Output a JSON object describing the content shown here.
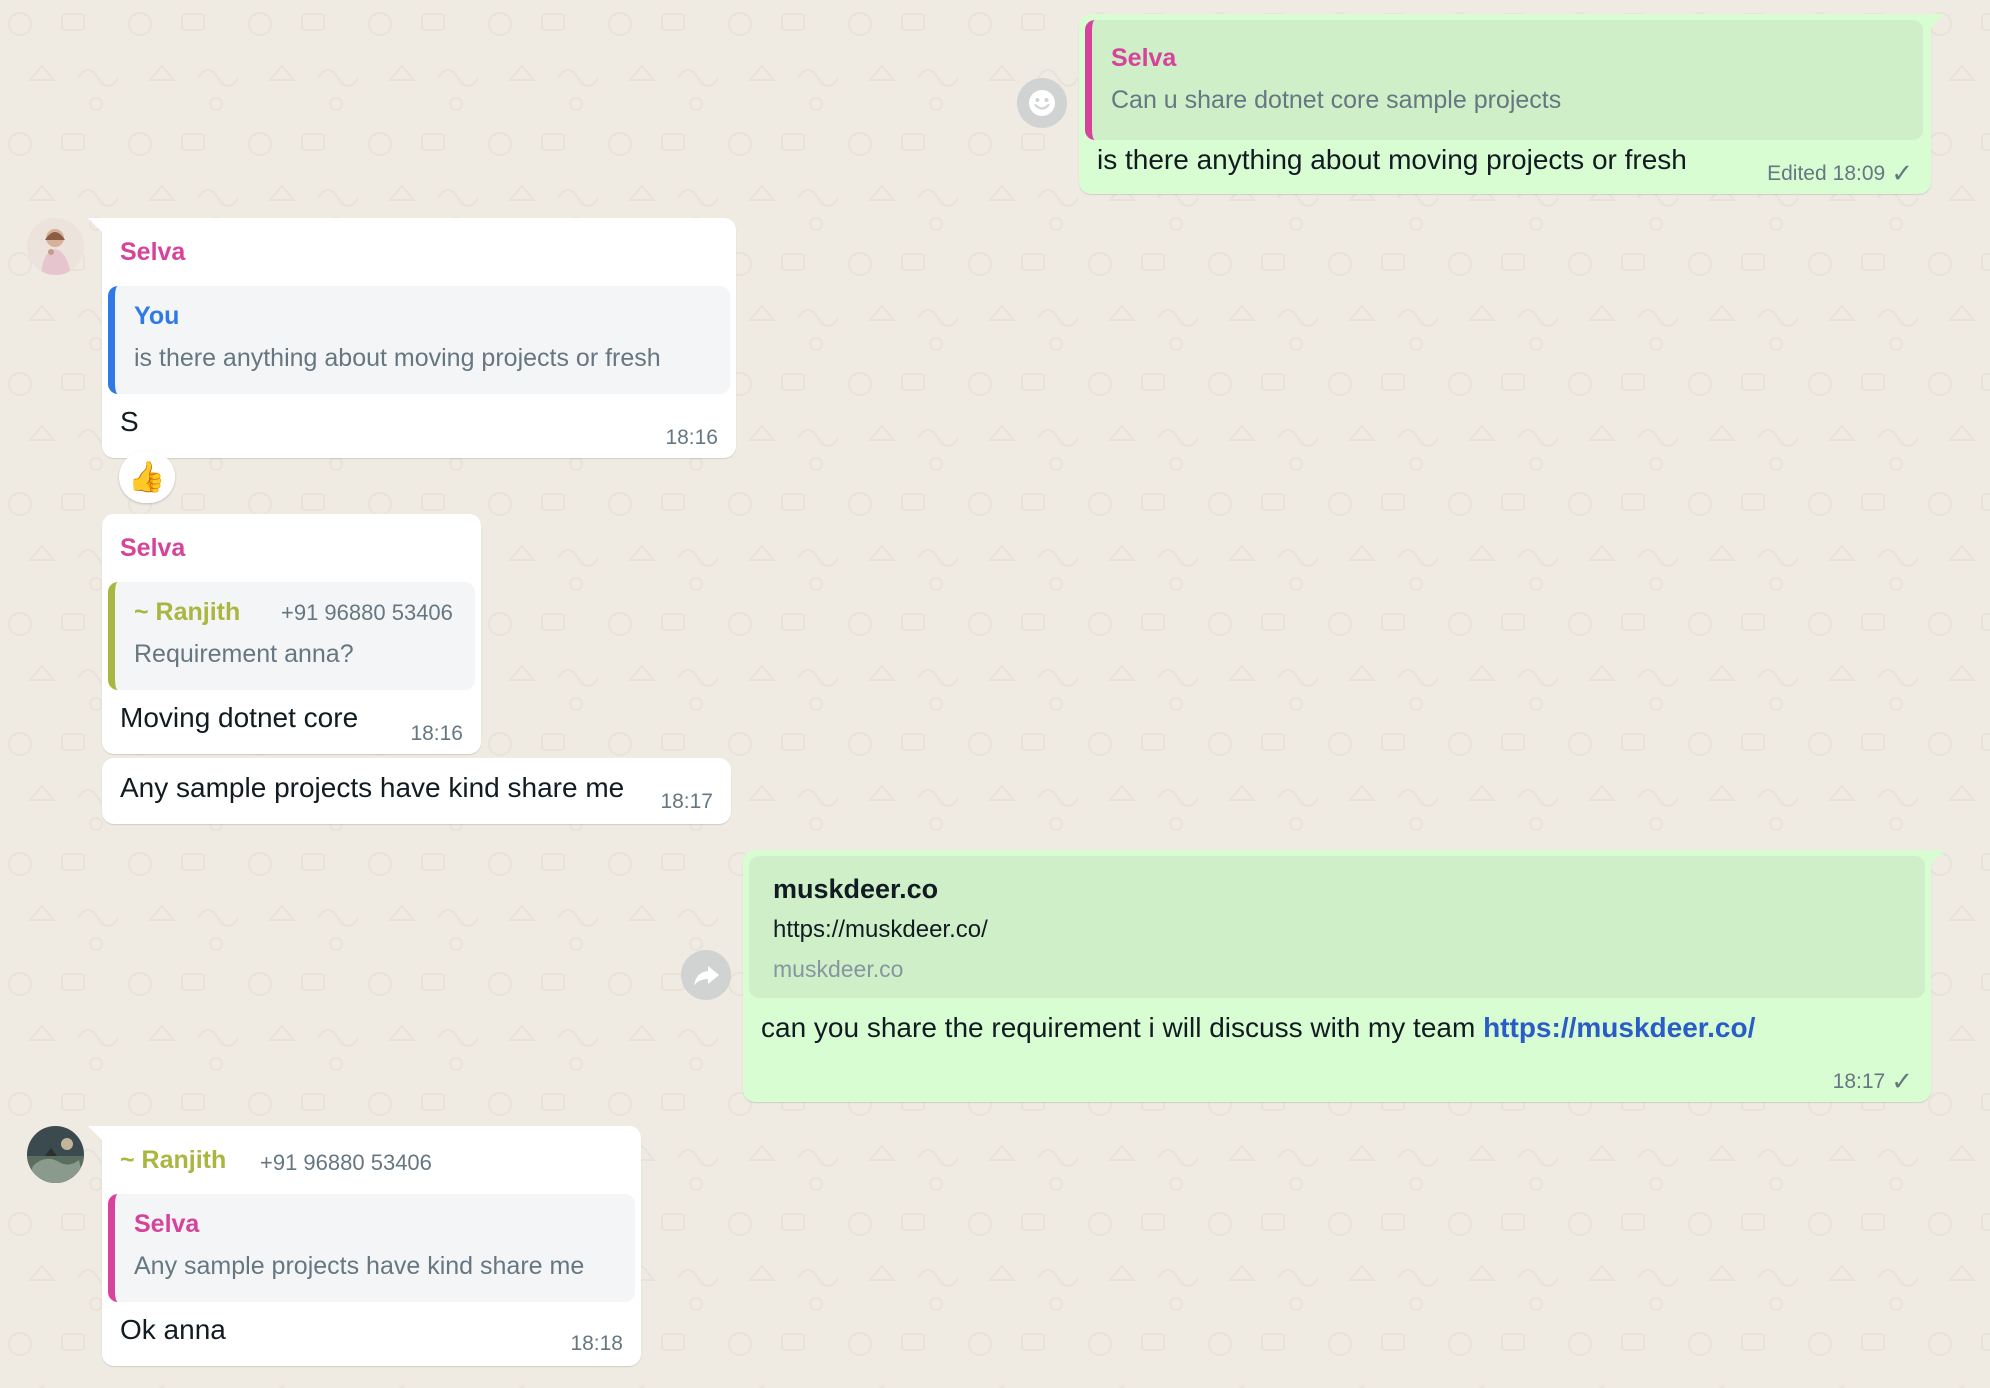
{
  "colors": {
    "chat_background": "#efeae2",
    "incoming_bubble": "#ffffff",
    "outgoing_bubble": "#d9fdd3",
    "selva_name": "#d6439a",
    "you_name": "#2f7be6",
    "ranjith_name": "#a9b640",
    "link": "#2a5cc7",
    "meta_text": "#667781"
  },
  "messages": [
    {
      "direction": "out",
      "quoted_sender": "Selva",
      "quoted_text": "Can u share dotnet core sample projects",
      "text": "is there anything about moving projects or fresh",
      "edited_label": "Edited",
      "time": "18:09",
      "status_icon": "single-check-icon",
      "side_button_icon": "emoji-icon"
    },
    {
      "direction": "in",
      "sender": "Selva",
      "avatar_icon": "user-photo-selva",
      "quoted_sender": "You",
      "quoted_text": "is there anything about moving projects or fresh",
      "text": "S",
      "time": "18:16",
      "reaction": "👍"
    },
    {
      "direction": "in",
      "sender": "Selva",
      "quoted_sender": "~ Ranjith",
      "quoted_phone": "+91 96880 53406",
      "quoted_text": "Requirement anna?",
      "text": "Moving dotnet core",
      "time": "18:16"
    },
    {
      "direction": "in",
      "text": "Any sample projects have kind share me",
      "time": "18:17"
    },
    {
      "direction": "out",
      "link_preview": {
        "title": "muskdeer.co",
        "url": "https://muskdeer.co/",
        "domain": "muskdeer.co"
      },
      "text": "can you share the requirement i will discuss with my team",
      "link_text": "https://muskdeer.co/",
      "time": "18:17",
      "status_icon": "single-check-icon",
      "side_button_icon": "forward-icon"
    },
    {
      "direction": "in",
      "sender": "~ Ranjith",
      "sender_phone": "+91 96880 53406",
      "avatar_icon": "user-photo-ranjith",
      "quoted_sender": "Selva",
      "quoted_text": "Any sample projects have kind share me",
      "text": "Ok anna",
      "time": "18:18"
    }
  ]
}
